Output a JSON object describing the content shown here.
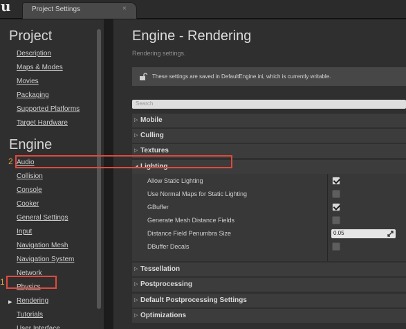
{
  "app": {
    "logo": "u",
    "tab_title": "Project Settings",
    "tab_close": "×"
  },
  "sidebar": {
    "sections": [
      {
        "heading": "Project",
        "items": [
          "Description",
          "Maps & Modes",
          "Movies",
          "Packaging",
          "Supported Platforms",
          "Target Hardware"
        ]
      },
      {
        "heading": "Engine",
        "items": [
          "Audio",
          "Collision",
          "Console",
          "Cooker",
          "General Settings",
          "Input",
          "Navigation Mesh",
          "Navigation System",
          "Network",
          "Physics",
          "Rendering",
          "Tutorials",
          "User Interface"
        ]
      }
    ],
    "selected": "Rendering",
    "selected_arrow": "▶",
    "marker": "1"
  },
  "main": {
    "title": "Engine - Rendering",
    "subtitle": "Rendering settings.",
    "notice": "These settings are saved in DefaultEngine.ini, which is currently writable.",
    "search_placeholder": "Search",
    "categories_before": [
      "Mobile",
      "Culling",
      "Textures"
    ],
    "expanded_category": "Lighting",
    "collapsed_arrow": "▷",
    "expanded_arrow": "◢",
    "lighting_props": [
      {
        "label": "Allow Static Lighting",
        "type": "checkbox",
        "checked": true
      },
      {
        "label": "Use Normal Maps for Static Lighting",
        "type": "checkbox",
        "checked": false
      },
      {
        "label": "GBuffer",
        "type": "checkbox",
        "checked": true
      },
      {
        "label": "Generate Mesh Distance Fields",
        "type": "checkbox",
        "checked": false
      },
      {
        "label": "Distance Field Penumbra Size",
        "type": "number",
        "value": "0.05"
      },
      {
        "label": "DBuffer Decals",
        "type": "checkbox",
        "checked": false
      }
    ],
    "categories_after": [
      "Tessellation",
      "Postprocessing",
      "Default Postprocessing Settings",
      "Optimizations"
    ],
    "marker": "2"
  },
  "colors": {
    "highlight": "#e04a3e",
    "marker": "#e0a040",
    "panel": "#2f2f2f",
    "header_row": "#3c3c3c"
  }
}
